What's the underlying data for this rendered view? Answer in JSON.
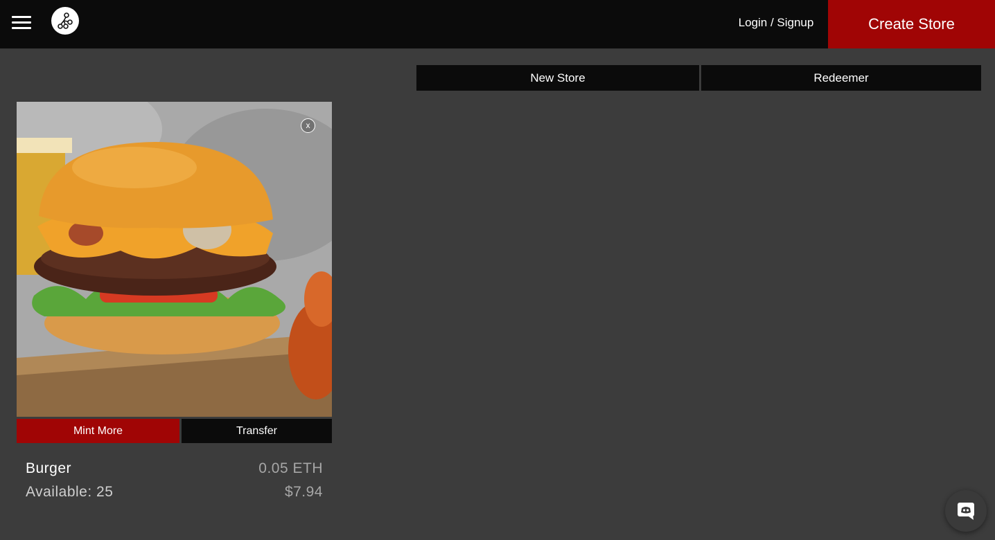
{
  "header": {
    "menu_icon": "hamburger-menu-icon",
    "logo_icon": "network-nodes-logo-icon",
    "login_label": "Login / Signup",
    "create_store_label": "Create Store",
    "accent_color": "#a00505",
    "background_color": "#0b0b0b"
  },
  "subnav": {
    "new_store_label": "New Store",
    "redeemer_label": "Redeemer"
  },
  "card": {
    "image_alt": "burger",
    "close_label": "x",
    "mint_more_label": "Mint More",
    "transfer_label": "Transfer",
    "name": "Burger",
    "available": "Available: 25",
    "price_eth": "0.05 ETH",
    "price_usd": "$7.94"
  },
  "floating": {
    "discord_icon": "discord-icon"
  },
  "page": {
    "background_color": "#3c3c3c"
  }
}
